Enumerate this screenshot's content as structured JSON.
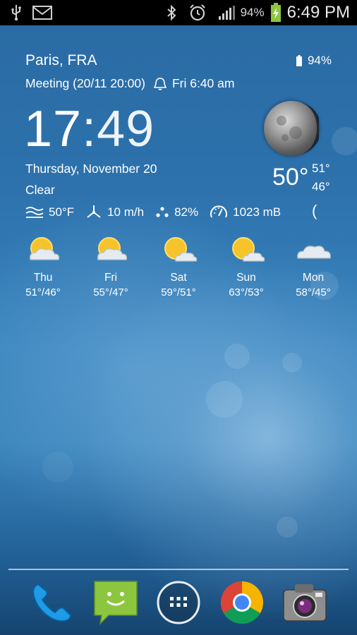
{
  "status_bar": {
    "battery_pct": "94%",
    "time": "6:49 PM",
    "icons_left": [
      "usb-icon",
      "mail-icon"
    ],
    "icons_right": [
      "bluetooth-icon",
      "alarm-icon",
      "signal-icon",
      "battery-charging-icon"
    ]
  },
  "widget": {
    "location": "Paris, FRA",
    "battery": "94%",
    "meeting": "Meeting (20/11 20:00)",
    "alarm": "Fri 6:40 am",
    "clock_hours": "17",
    "clock_sep": ":",
    "clock_minutes": "49",
    "date": "Thursday, November 20",
    "condition": "Clear",
    "current_temp": "50°",
    "high": "51°",
    "low": "46°",
    "feels_like": "50°F",
    "wind": "10 m/h",
    "humidity": "82%",
    "pressure": "1023 mB",
    "moon_symbol": "("
  },
  "forecast": [
    {
      "day": "Thu",
      "range": "51°/46°",
      "icon": "sun-cloud-icon"
    },
    {
      "day": "Fri",
      "range": "55°/47°",
      "icon": "sun-cloud-icon"
    },
    {
      "day": "Sat",
      "range": "59°/51°",
      "icon": "sun-cloud-icon"
    },
    {
      "day": "Sun",
      "range": "63°/53°",
      "icon": "sun-cloud-icon"
    },
    {
      "day": "Mon",
      "range": "58°/45°",
      "icon": "cloud-icon"
    }
  ],
  "dock": [
    "phone-icon",
    "messaging-icon",
    "app-drawer-icon",
    "chrome-icon",
    "camera-icon"
  ],
  "colors": {
    "accent_green": "#8cc63f",
    "wallpaper": "#2d72ad"
  }
}
